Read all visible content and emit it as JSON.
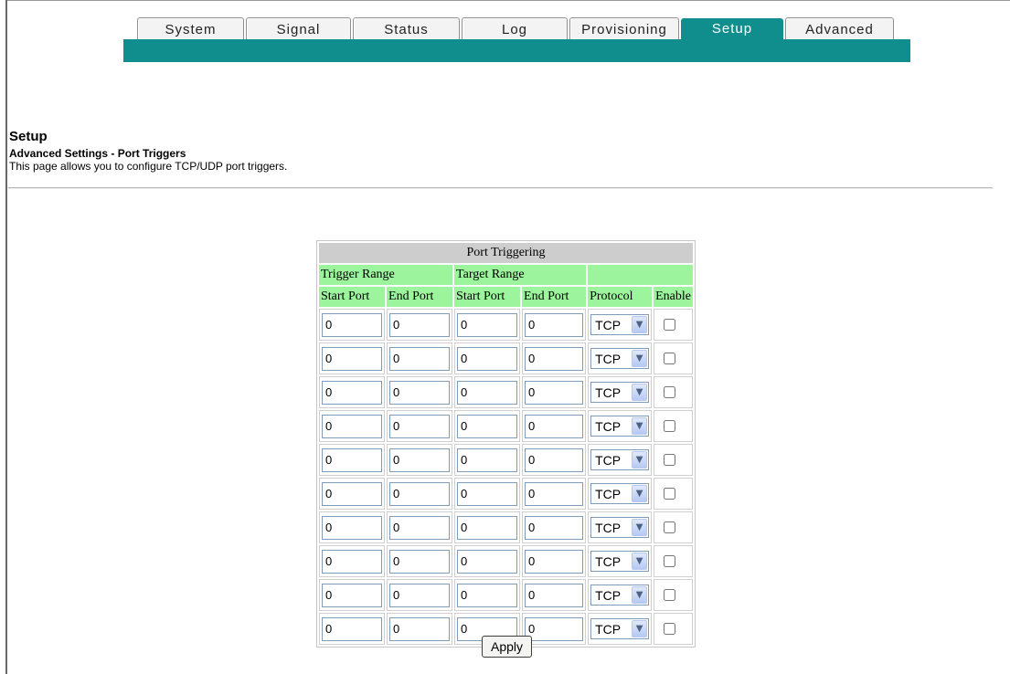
{
  "tabs": [
    "System",
    "Signal",
    "Status",
    "Log",
    "Provisioning",
    "Setup",
    "Advanced"
  ],
  "active_tab": "Setup",
  "page": {
    "title": "Setup",
    "subtitle": "Advanced Settings - Port Triggers",
    "description": "This page allows you to configure TCP/UDP port triggers."
  },
  "table": {
    "title": "Port Triggering",
    "group_trigger": "Trigger Range",
    "group_target": "Target Range",
    "columns": [
      "Start Port",
      "End Port",
      "Start Port",
      "End Port",
      "Protocol",
      "Enable"
    ],
    "rows": [
      {
        "trigger_start": "0",
        "trigger_end": "0",
        "target_start": "0",
        "target_end": "0",
        "protocol": "TCP",
        "enabled": false
      },
      {
        "trigger_start": "0",
        "trigger_end": "0",
        "target_start": "0",
        "target_end": "0",
        "protocol": "TCP",
        "enabled": false
      },
      {
        "trigger_start": "0",
        "trigger_end": "0",
        "target_start": "0",
        "target_end": "0",
        "protocol": "TCP",
        "enabled": false
      },
      {
        "trigger_start": "0",
        "trigger_end": "0",
        "target_start": "0",
        "target_end": "0",
        "protocol": "TCP",
        "enabled": false
      },
      {
        "trigger_start": "0",
        "trigger_end": "0",
        "target_start": "0",
        "target_end": "0",
        "protocol": "TCP",
        "enabled": false
      },
      {
        "trigger_start": "0",
        "trigger_end": "0",
        "target_start": "0",
        "target_end": "0",
        "protocol": "TCP",
        "enabled": false
      },
      {
        "trigger_start": "0",
        "trigger_end": "0",
        "target_start": "0",
        "target_end": "0",
        "protocol": "TCP",
        "enabled": false
      },
      {
        "trigger_start": "0",
        "trigger_end": "0",
        "target_start": "0",
        "target_end": "0",
        "protocol": "TCP",
        "enabled": false
      },
      {
        "trigger_start": "0",
        "trigger_end": "0",
        "target_start": "0",
        "target_end": "0",
        "protocol": "TCP",
        "enabled": false
      },
      {
        "trigger_start": "0",
        "trigger_end": "0",
        "target_start": "0",
        "target_end": "0",
        "protocol": "TCP",
        "enabled": false
      }
    ]
  },
  "apply_label": "Apply",
  "icons": {
    "dropdown": "chevron-down-icon"
  },
  "colors": {
    "tab_active": "#0f8e8d",
    "header_green": "#9cf49c",
    "header_gray": "#cdcdcd"
  }
}
